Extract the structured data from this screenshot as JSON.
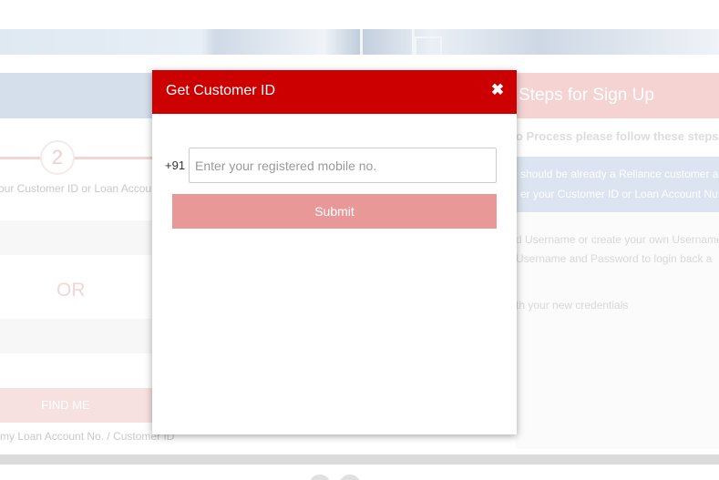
{
  "background": {
    "step_number": "2",
    "step_label": "our Customer ID or Loan Accou",
    "or_text": "OR",
    "find_button": "FIND ME",
    "bottom_note": "my Loan Account No. / Customer ID",
    "right_panel": {
      "title": "Steps for Sign Up",
      "intro": "o Process please follow these steps:",
      "box_line1": "should be already a Reliance customer a",
      "box_line2": "er your Customer ID or Loan Account Nu",
      "line1": "d Username or create your own Username",
      "line2": "Username and Password to login back a",
      "line3": "th your new credentials"
    }
  },
  "modal": {
    "title": "Get Customer ID",
    "close_icon": "close-icon",
    "close_glyph": "✖",
    "country_code": "+91",
    "mobile_placeholder": "Enter your registered mobile no.",
    "submit_label": "Submit"
  },
  "colors": {
    "header_red": "#cc0000",
    "submit_pink": "#e99898"
  }
}
